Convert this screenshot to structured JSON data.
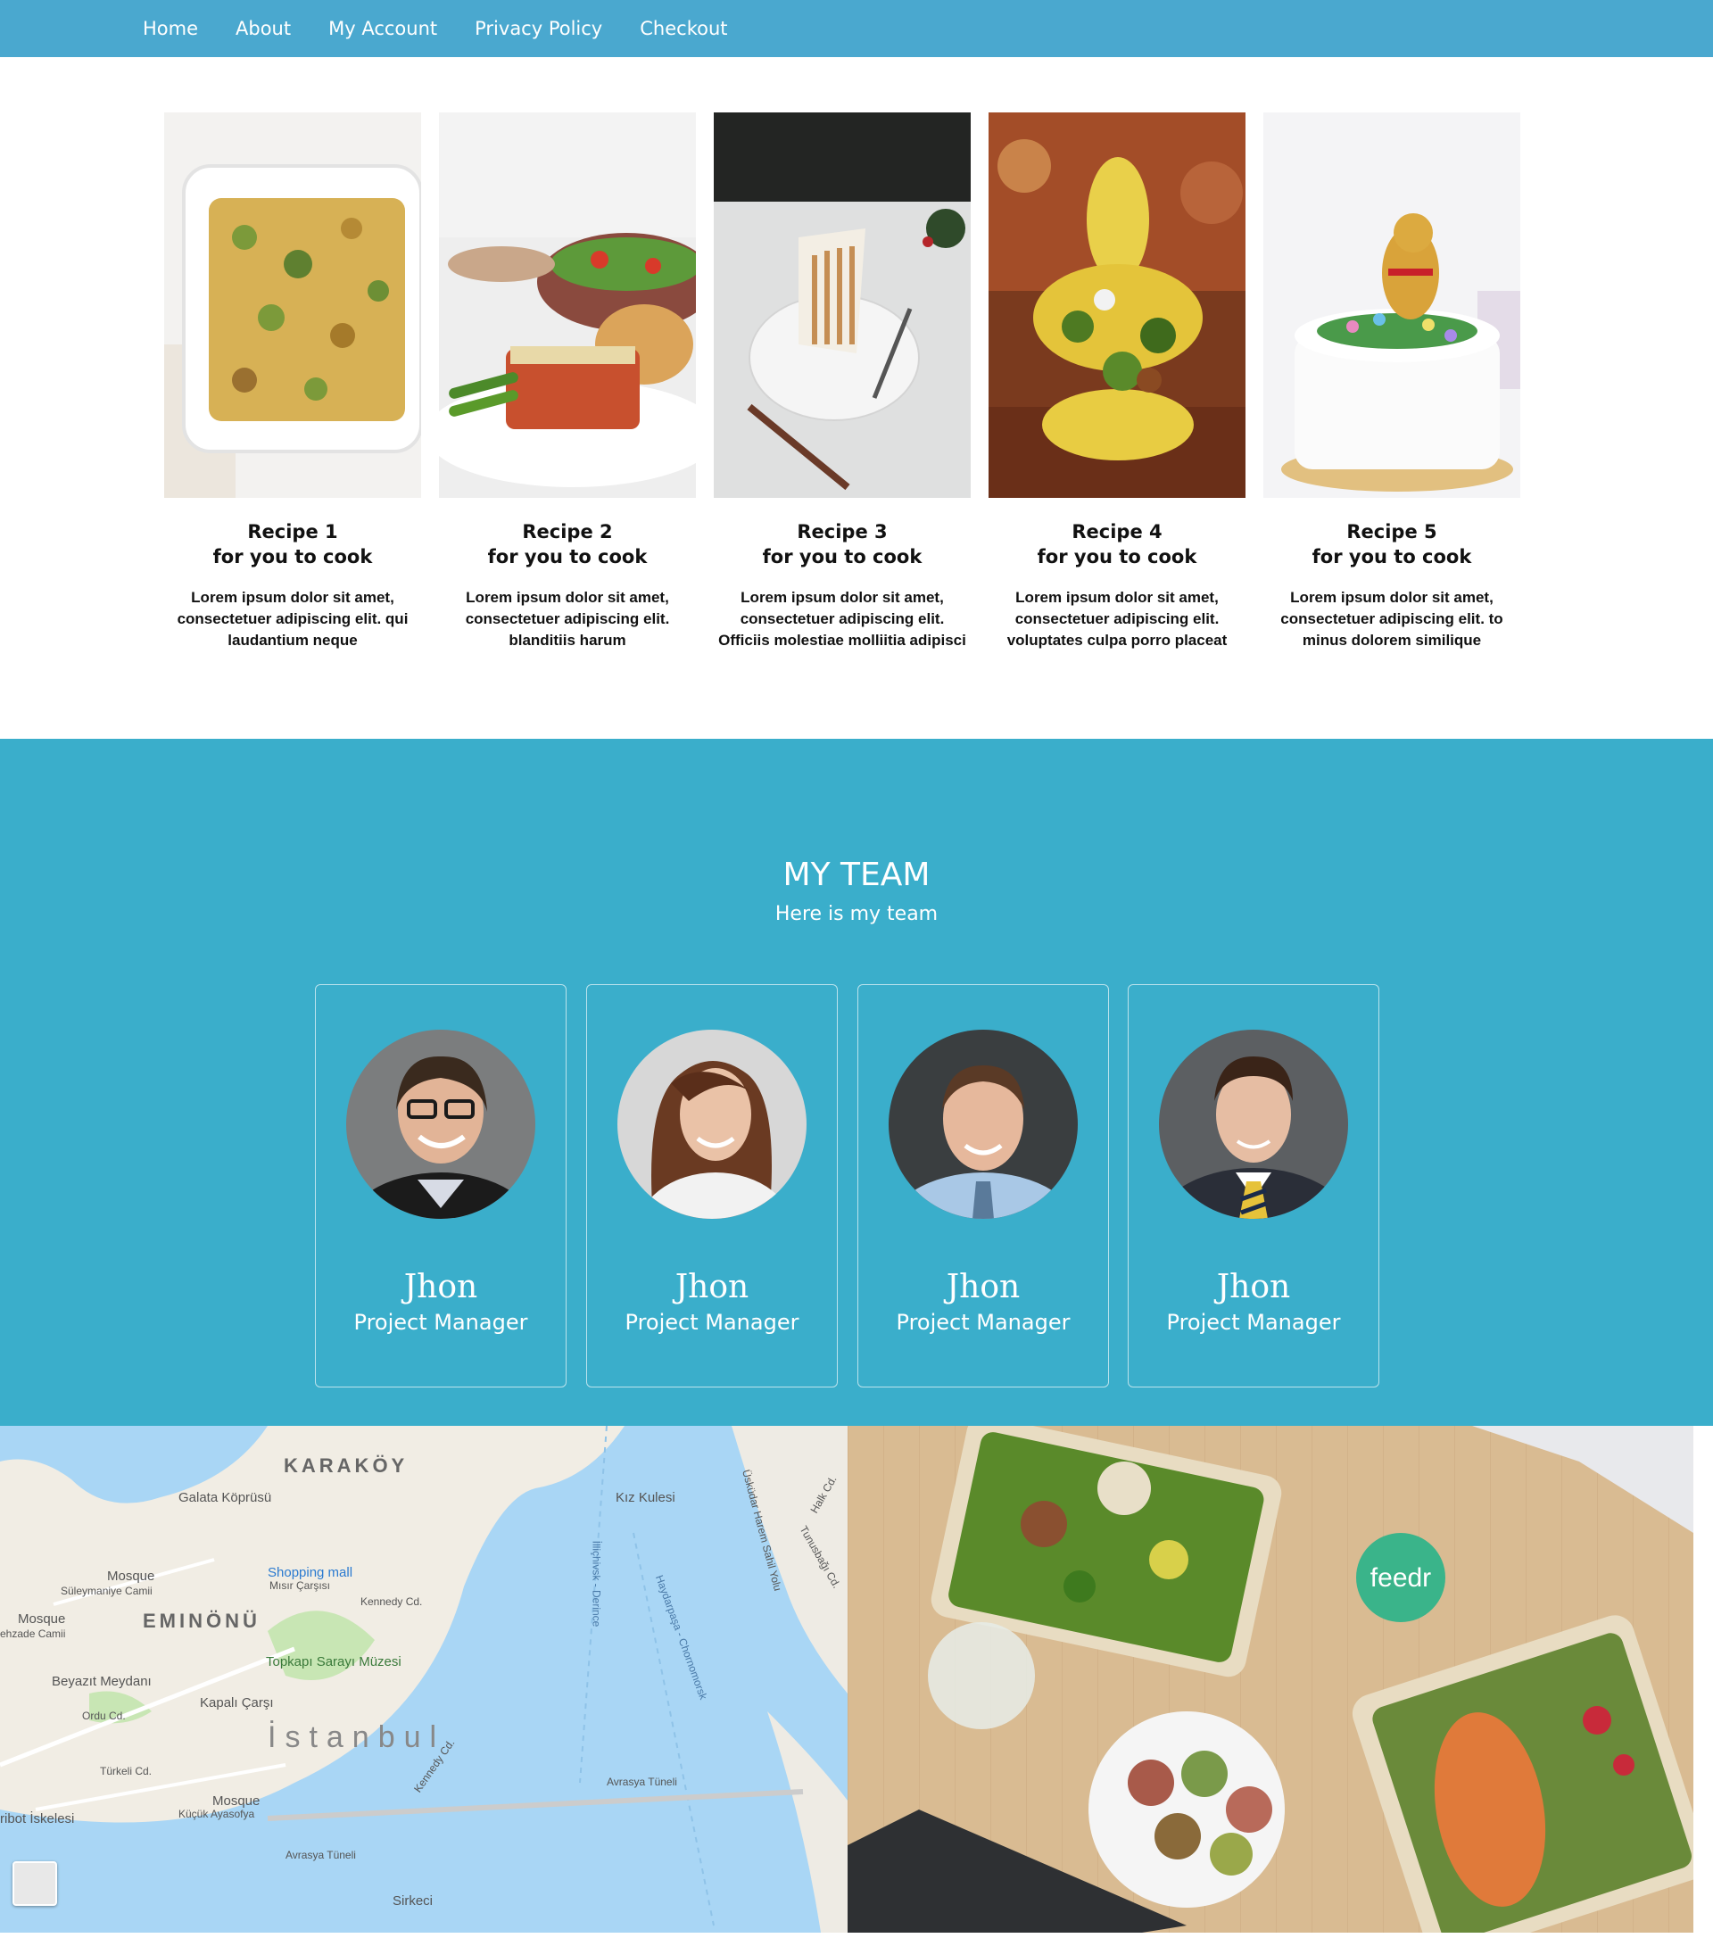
{
  "nav": {
    "items": [
      "Home",
      "About",
      "My Account",
      "Privacy Policy",
      "Checkout"
    ]
  },
  "recipes": [
    {
      "title": "Recipe 1",
      "subtitle": "for you to cook",
      "desc": "Lorem ipsum dolor sit amet, consectetuer adipiscing elit. qui laudantium neque"
    },
    {
      "title": "Recipe 2",
      "subtitle": "for you to cook",
      "desc": "Lorem ipsum dolor sit amet, consectetuer adipiscing elit. blanditiis harum"
    },
    {
      "title": "Recipe 3",
      "subtitle": "for you to cook",
      "desc": "Lorem ipsum dolor sit amet, consectetuer adipiscing elit. Officiis molestiae molliitia adipisci"
    },
    {
      "title": "Recipe 4",
      "subtitle": "for you to cook",
      "desc": "Lorem ipsum dolor sit amet, consectetuer adipiscing elit. voluptates culpa porro placeat"
    },
    {
      "title": "Recipe 5",
      "subtitle": "for you to cook",
      "desc": "Lorem ipsum dolor sit amet, consectetuer adipiscing elit. to minus dolorem similique"
    }
  ],
  "team": {
    "title": "MY TEAM",
    "subtitle": "Here is my team",
    "members": [
      {
        "name": "Jhon",
        "role": "Project Manager"
      },
      {
        "name": "Jhon",
        "role": "Project Manager"
      },
      {
        "name": "Jhon",
        "role": "Project Manager"
      },
      {
        "name": "Jhon",
        "role": "Project Manager"
      }
    ]
  },
  "map": {
    "labels": [
      "KARAKÖY",
      "Galata Köprüsü",
      "Kız Kulesi",
      "Mosque",
      "Süleymaniye Camii",
      "Shopping mall",
      "Mısır Çarşısı",
      "Mosque",
      "EMINÖNÜ",
      "Kennedy Cd.",
      "Topkapı Sarayı Müzesi",
      "Beyazıt Meydanı",
      "Kapalı Çarşı",
      "Ordu Cd.",
      "İstanbul",
      "Türkeli Cd.",
      "Mosque",
      "Küçük Ayasofya",
      "Avrasya Tüneli",
      "Sirkeci",
      "Üsküdar Harem Sahil Yolu",
      "Haydarpaşa - Chornomorsk",
      "İlliçhivsk - Derince",
      "Tunusbağı Cd.",
      "Halk Cd.",
      "Avrasya Tüneli",
      "ehzade Camii",
      "ribot İskelesi",
      "Kennedy Cd."
    ]
  },
  "food": {
    "brand_lid": "feedr"
  },
  "colors": {
    "nav_bg": "#4aa8cf",
    "team_bg": "#3aaecb",
    "water": "#a9d6f5"
  }
}
